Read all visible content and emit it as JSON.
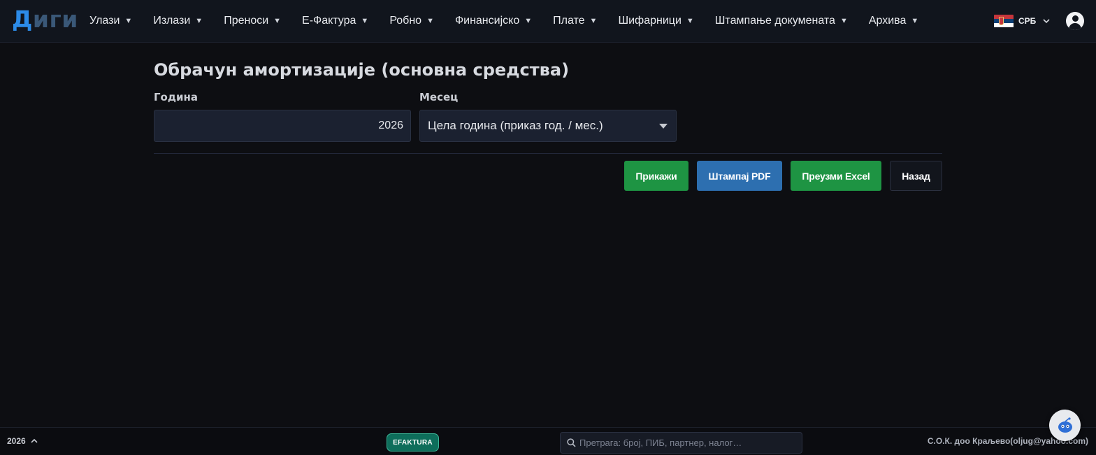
{
  "app": {
    "logo_part1": "Д",
    "logo_part2": "иги"
  },
  "nav": {
    "items": [
      {
        "label": "Улази"
      },
      {
        "label": "Излази"
      },
      {
        "label": "Преноси"
      },
      {
        "label": "Е-Фактура"
      },
      {
        "label": "Робно"
      },
      {
        "label": "Финансијско"
      },
      {
        "label": "Плате"
      },
      {
        "label": "Шифарници"
      },
      {
        "label": "Штампање докумената"
      },
      {
        "label": "Архива"
      }
    ],
    "caret_icon": "caret-down-icon",
    "language": "СРБ",
    "language_flag_icon": "serbia-flag-icon",
    "user_icon": "user-avatar-icon"
  },
  "page": {
    "title": "Обрачун амортизације (основна средства)",
    "year_label": "Година",
    "year_value": "2026",
    "month_label": "Месец",
    "month_value": "Цела година (приказ год. / мес.)"
  },
  "buttons": {
    "show": "Прикажи",
    "print_pdf": "Штампај PDF",
    "download_excel": "Преузми Excel",
    "back": "Назад"
  },
  "footer": {
    "year": "2026",
    "efaktura_badge": "EFAKTURA",
    "search_placeholder": "Претрага: број, ПИБ, партнер, налог…",
    "company": "С.О.К. доо Краљево(oljug@yahoo.com)"
  },
  "colors": {
    "accent_blue": "#2c8be8",
    "button_green": "#1e9443",
    "button_blue": "#2d6fb0",
    "efaktura_teal": "#0e6e5b"
  }
}
